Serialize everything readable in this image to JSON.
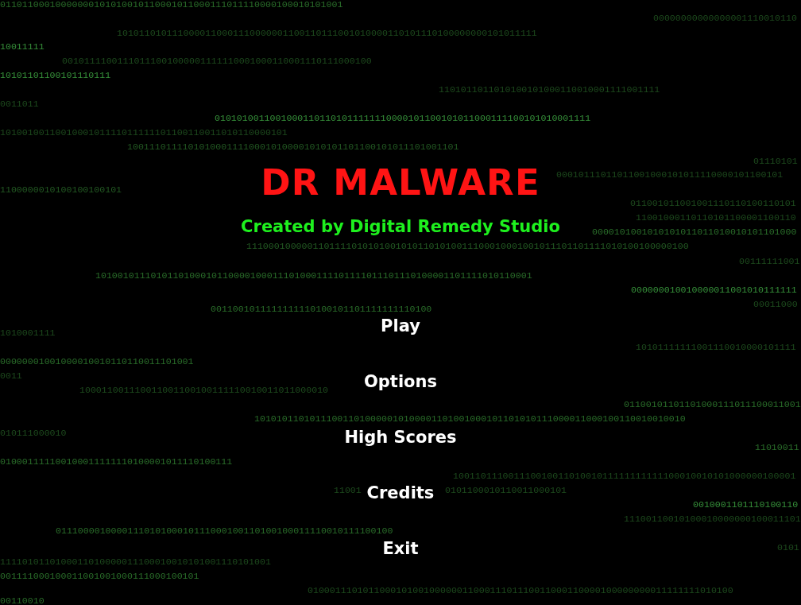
{
  "title": "DR MALWARE",
  "subtitle": "Created by Digital Remedy Studio",
  "menu": [
    {
      "label": "Play"
    },
    {
      "label": "Options"
    },
    {
      "label": "High Scores"
    },
    {
      "label": "Credits"
    },
    {
      "label": "Exit"
    }
  ],
  "background_code": [
    "01101100010000000101010010110001011000111011110000100010101001",
    "00000000000000001110010110",
    "1010110101110000110001110000001100110111001010000110101110100000000101011111",
    "10011111",
    "00101111001110111001000001111110001000110001110111000100",
    "10101101100101110111",
    "1101011011010100101000110010001111001111",
    "0011011",
    "01010100110010001101101011111110000101100101011000111100101010001111",
    "1010010011001000101111011111101100110011010110000101",
    "100111011110101000111100010100001010101101100101011101001101",
    "01110101",
    "00010111011011001000101011110000101100101",
    "1100000010100100100101",
    "011001011001001110110100110101",
    "11001000110110101100001100110",
    "0000101001010101011011010010101101000",
    "11100010000011011110101010010101101010011100010001001011101101111010100100000100",
    "00111111001",
    "1010010111010110100010110000100011101000111101111011101110100001101111010110001",
    "000000010010000011001010111111",
    "00011000",
    "0011001011111111110100101101111111110100",
    "1010001111",
    "10101111111001110010000101111",
    "00000001001000010010110110011101001",
    "0011",
    "100011001110011001100100111110010011011000010",
    "01100101101101000111011100011001",
    "101010110101110011010000010100001101001000101101010111000011000100110010010010",
    "010111000010",
    "11010011",
    "010001111100100011111110100001011110100111",
    "10011011100111001001101001011111111111100010010101000000100001",
    "11001",
    "0101100010110011000101",
    "0010001101110100110",
    "11100110010100010000000100011101",
    "0111000010000111010100010111000100110100100011110010111100100",
    "0101",
    "1111010110100011010000011100010010101001110101001",
    "001111000100011001001000111000100101",
    "01000111010110001010010000001100011101110011000110000100000000011111111010100",
    "00110010"
  ]
}
